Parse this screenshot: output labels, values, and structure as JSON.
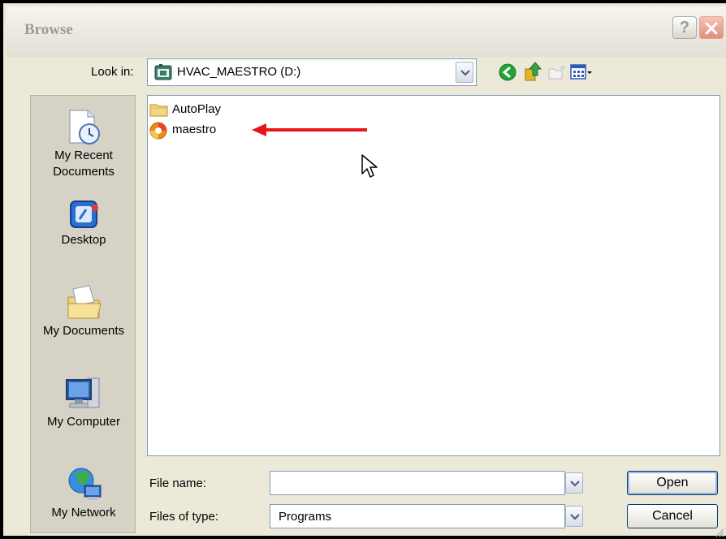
{
  "window": {
    "title": "Browse",
    "help_glyph": "?"
  },
  "look_in": {
    "label": "Look in:",
    "value": "HVAC_MAESTRO (D:)",
    "icon": "drive-icon"
  },
  "toolbar": {
    "buttons": [
      {
        "name": "back-icon",
        "color": "#22a33a"
      },
      {
        "name": "up-folder-icon",
        "color": "#e3b32c"
      },
      {
        "name": "new-folder-icon",
        "color": "#c4c4c4"
      },
      {
        "name": "view-menu-icon",
        "color": "#2a5bb8"
      }
    ]
  },
  "places": [
    {
      "label_lines": [
        "My Recent",
        "Documents"
      ],
      "icon": "recent-documents-icon"
    },
    {
      "label_lines": [
        "Desktop"
      ],
      "icon": "desktop-icon"
    },
    {
      "label_lines": [
        "My Documents"
      ],
      "icon": "my-documents-icon"
    },
    {
      "label_lines": [
        "My Computer"
      ],
      "icon": "my-computer-icon"
    },
    {
      "label_lines": [
        "My Network"
      ],
      "icon": "my-network-icon"
    }
  ],
  "files": [
    {
      "label": "AutoPlay",
      "icon": "folder-icon"
    },
    {
      "label": "maestro",
      "icon": "program-icon"
    }
  ],
  "annotation": {
    "color": "#e8141b"
  },
  "file_name": {
    "label": "File name:",
    "value": ""
  },
  "file_type": {
    "label": "Files of type:",
    "value": "Programs"
  },
  "buttons": {
    "open": "Open",
    "cancel": "Cancel"
  }
}
